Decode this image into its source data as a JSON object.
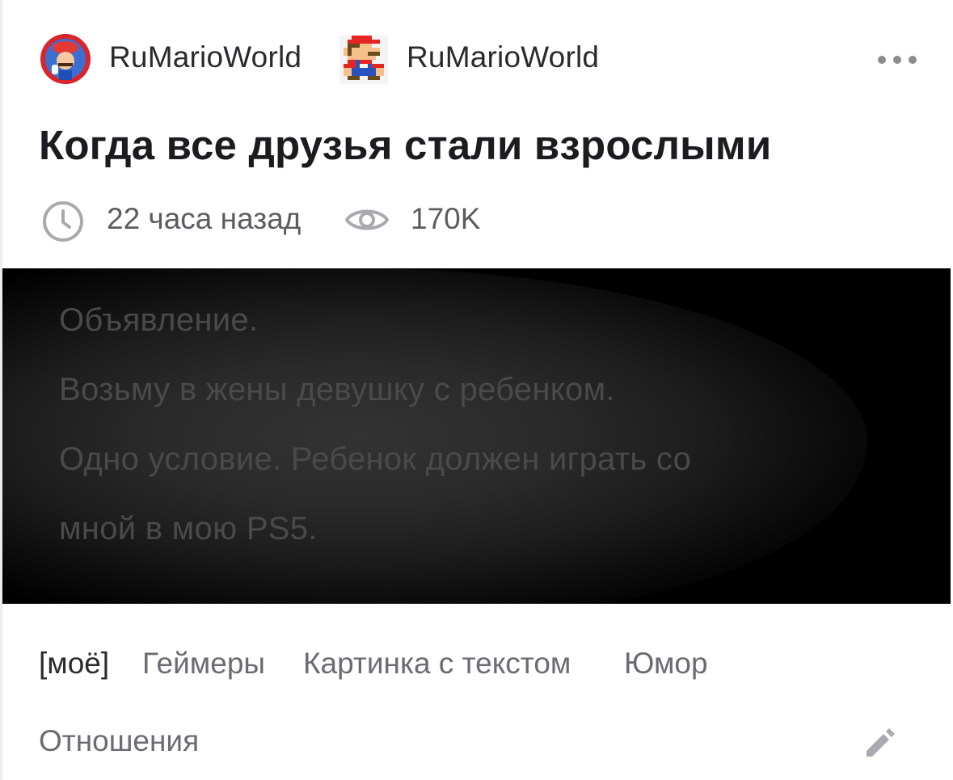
{
  "post": {
    "author": {
      "name": "RuMarioWorld",
      "avatar": "mario-thumbs-up-avatar"
    },
    "community": {
      "name": "RuMarioWorld",
      "icon": "pixel-mario-icon"
    },
    "more_icon": "more-dots-icon",
    "title": "Когда все друзья стали взрослыми",
    "meta": {
      "time_icon": "clock-icon",
      "time": "22 часа назад",
      "views_icon": "eye-icon",
      "views": "170K"
    },
    "image_text": [
      "Объявление.",
      "Возьму в жены девушку с ребенком.",
      "Одно условие. Ребенок должен играть со",
      "мной в мою PS5."
    ],
    "tags": [
      "[моё]",
      "Геймеры",
      "Картинка с текстом",
      "Юмор",
      "Отношения"
    ],
    "edit_icon": "pencil-icon"
  },
  "colors": {
    "text_primary": "#1c1c20",
    "text_secondary": "#6b6b73",
    "icon_gray": "#a9a9b0",
    "image_bg": "#000000"
  }
}
